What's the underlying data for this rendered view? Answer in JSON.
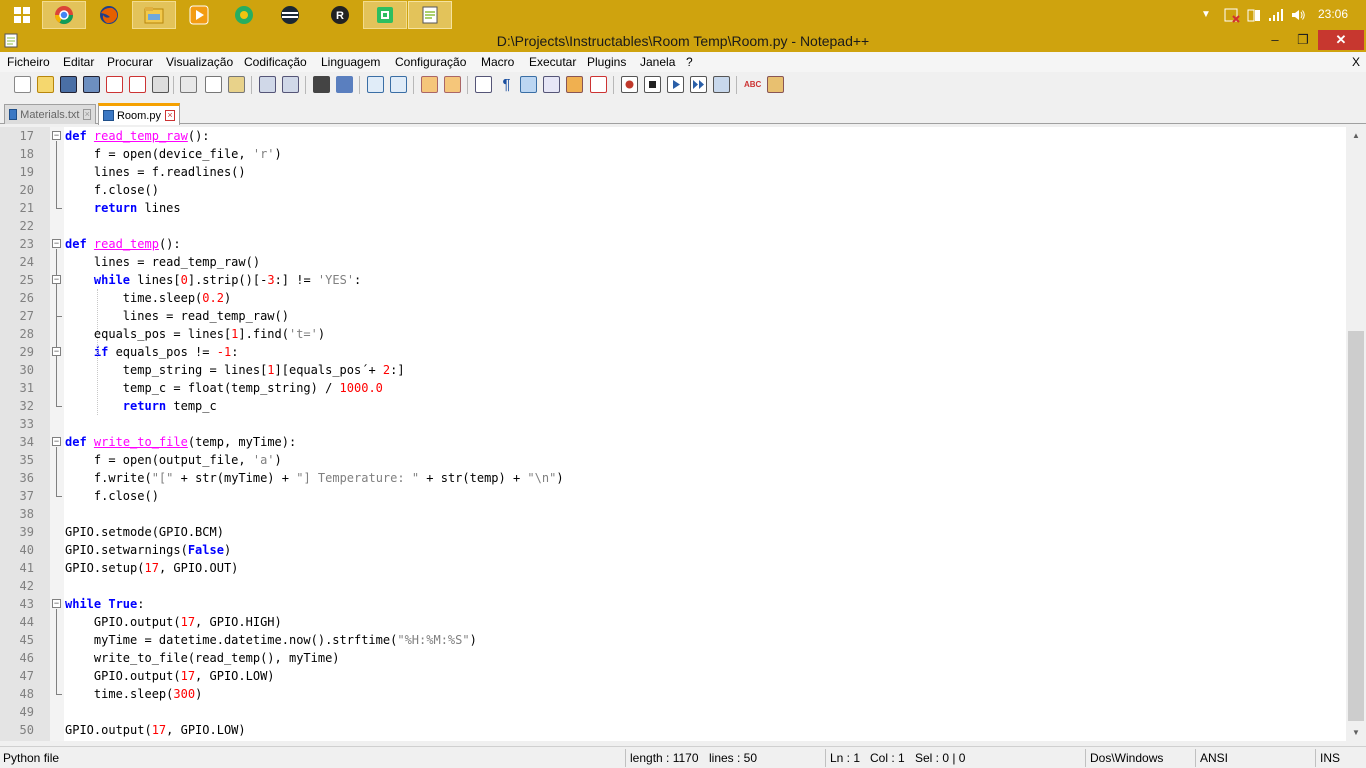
{
  "taskbar": {
    "apps": [
      {
        "icon": "windows-start-icon",
        "color": "#ffffff"
      },
      {
        "icon": "chrome-icon",
        "color": "#db4437"
      },
      {
        "icon": "firefox-icon",
        "color": "#e66000"
      },
      {
        "icon": "file-explorer-icon",
        "color": "#f2c94c"
      },
      {
        "icon": "media-player-icon",
        "color": "#f39c12"
      },
      {
        "icon": "maps-app-icon",
        "color": "#27ae60"
      },
      {
        "icon": "stripes-app-icon",
        "color": "#2c3e50"
      },
      {
        "icon": "r-app-icon",
        "color": "#333333"
      },
      {
        "icon": "evernote-icon",
        "color": "#2dbe60"
      },
      {
        "icon": "notepadpp-icon",
        "color": "#8fbf3f"
      }
    ],
    "clock": "23:06"
  },
  "window": {
    "title": "D:\\Projects\\Instructables\\Room Temp\\Room.py - Notepad++",
    "minimize": "–",
    "maximize": "❐",
    "close": "✕"
  },
  "menu": [
    "Ficheiro",
    "Editar",
    "Procurar",
    "Visualização",
    "Codificação",
    "Linguagem",
    "Configuração",
    "Macro",
    "Executar",
    "Plugins",
    "Janela",
    "?"
  ],
  "menu_close": "X",
  "tabs": [
    {
      "label": "Materials.txt",
      "active": false
    },
    {
      "label": "Room.py",
      "active": true
    }
  ],
  "code_lines": [
    {
      "n": "17",
      "t": "def read_temp_raw():"
    },
    {
      "n": "18",
      "t": "    f = open(device_file, 'r')"
    },
    {
      "n": "19",
      "t": "    lines = f.readlines()"
    },
    {
      "n": "20",
      "t": "    f.close()"
    },
    {
      "n": "21",
      "t": "    return lines"
    },
    {
      "n": "22",
      "t": ""
    },
    {
      "n": "23",
      "t": "def read_temp():"
    },
    {
      "n": "24",
      "t": "    lines = read_temp_raw()"
    },
    {
      "n": "25",
      "t": "    while lines[0].strip()[-3:] != 'YES':"
    },
    {
      "n": "26",
      "t": "        time.sleep(0.2)"
    },
    {
      "n": "27",
      "t": "        lines = read_temp_raw()"
    },
    {
      "n": "28",
      "t": "    equals_pos = lines[1].find('t=')"
    },
    {
      "n": "29",
      "t": "    if equals_pos != -1:"
    },
    {
      "n": "30",
      "t": "        temp_string = lines[1][equals_pos´+ 2:]"
    },
    {
      "n": "31",
      "t": "        temp_c = float(temp_string) / 1000.0"
    },
    {
      "n": "32",
      "t": "        return temp_c"
    },
    {
      "n": "33",
      "t": ""
    },
    {
      "n": "34",
      "t": "def write_to_file(temp, myTime):"
    },
    {
      "n": "35",
      "t": "    f = open(output_file, 'a')"
    },
    {
      "n": "36",
      "t": "    f.write(\"[\" + str(myTime) + \"] Temperature: \" + str(temp) + \"\\n\")"
    },
    {
      "n": "37",
      "t": "    f.close()"
    },
    {
      "n": "38",
      "t": ""
    },
    {
      "n": "39",
      "t": "GPIO.setmode(GPIO.BCM)"
    },
    {
      "n": "40",
      "t": "GPIO.setwarnings(False)"
    },
    {
      "n": "41",
      "t": "GPIO.setup(17, GPIO.OUT)"
    },
    {
      "n": "42",
      "t": ""
    },
    {
      "n": "43",
      "t": "while True:"
    },
    {
      "n": "44",
      "t": "    GPIO.output(17, GPIO.HIGH)"
    },
    {
      "n": "45",
      "t": "    myTime = datetime.datetime.now().strftime(\"%H:%M:%S\")"
    },
    {
      "n": "46",
      "t": "    write_to_file(read_temp(), myTime)"
    },
    {
      "n": "47",
      "t": "    GPIO.output(17, GPIO.LOW)"
    },
    {
      "n": "48",
      "t": "    time.sleep(300)"
    },
    {
      "n": "49",
      "t": ""
    },
    {
      "n": "50",
      "t": "GPIO.output(17, GPIO.LOW)"
    }
  ],
  "status": {
    "file_type": "Python file",
    "length": "length : 1170",
    "lines": "lines : 50",
    "ln": "Ln : 1",
    "col": "Col : 1",
    "sel": "Sel : 0 | 0",
    "eol": "Dos\\Windows",
    "encoding": "ANSI",
    "mode": "INS"
  },
  "colors": {
    "taskbar": "#cfa30e",
    "keyword": "#0000ff",
    "function_name": "#ff00ff",
    "number": "#ff0000",
    "string": "#808080",
    "active_tab_accent": "#f5a100"
  }
}
